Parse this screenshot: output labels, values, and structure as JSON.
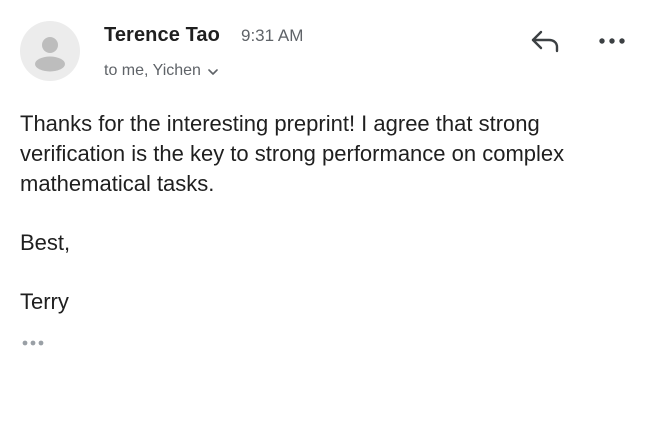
{
  "sender": {
    "name": "Terence Tao",
    "time": "9:31 AM"
  },
  "recipients": {
    "label": "to me, Yichen"
  },
  "icons": {
    "avatar": "person-icon",
    "recipients_toggle": "chevron-down-icon",
    "reply": "reply-icon",
    "more": "more-horizontal-icon",
    "trimmed": "ellipsis-icon"
  },
  "message": {
    "paragraphs": [
      "Thanks for the interesting preprint!  I agree that strong verification is the key to strong performance on complex mathematical tasks.",
      "Best,",
      "Terry"
    ]
  },
  "colors": {
    "text": "#1f1f1f",
    "secondary": "#5f6368",
    "avatar_bg": "#ececec",
    "avatar_fg": "#bdbdbd",
    "icon": "#3c4043"
  }
}
